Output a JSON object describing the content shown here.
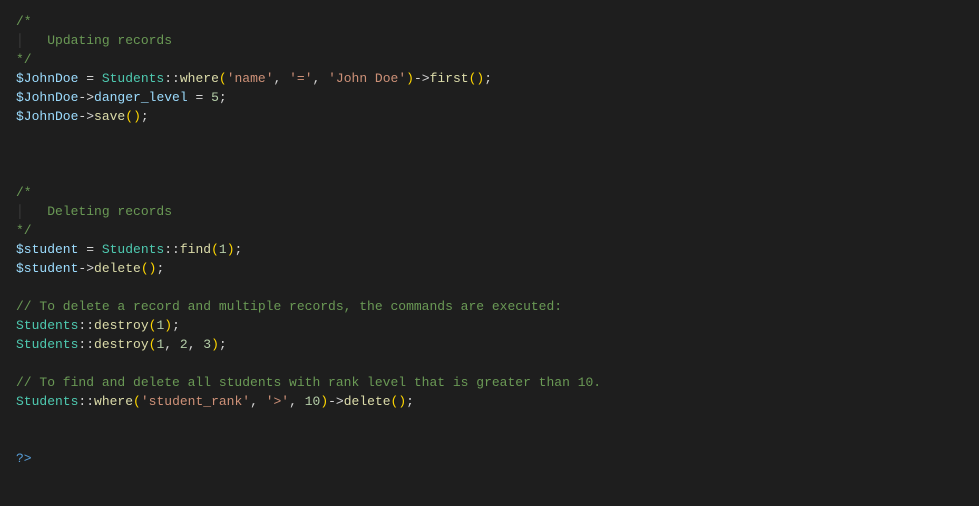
{
  "code": {
    "l1": "/*",
    "l2_indent": "    ",
    "l2_text": "Updating records",
    "l3": "*/",
    "l4_var": "$JohnDoe",
    "l4_eq": " = ",
    "l4_class": "Students",
    "l4_dcolon": "::",
    "l4_fn1": "where",
    "l4_p1": "(",
    "l4_s1": "'name'",
    "l4_c1": ", ",
    "l4_s2": "'='",
    "l4_c2": ", ",
    "l4_s3": "'John Doe'",
    "l4_p2": ")",
    "l4_arrow": "->",
    "l4_fn2": "first",
    "l4_p3": "(",
    "l4_p4": ")",
    "l4_semi": ";",
    "l5_var": "$JohnDoe",
    "l5_arrow": "->",
    "l5_prop": "danger_level",
    "l5_eq": " = ",
    "l5_num": "5",
    "l5_semi": ";",
    "l6_var": "$JohnDoe",
    "l6_arrow": "->",
    "l6_fn": "save",
    "l6_p1": "(",
    "l6_p2": ")",
    "l6_semi": ";",
    "l10": "/*",
    "l11_indent": "    ",
    "l11_text": "Deleting records",
    "l12": "*/",
    "l13_var": "$student",
    "l13_eq": " = ",
    "l13_class": "Students",
    "l13_dcolon": "::",
    "l13_fn": "find",
    "l13_p1": "(",
    "l13_num": "1",
    "l13_p2": ")",
    "l13_semi": ";",
    "l14_var": "$student",
    "l14_arrow": "->",
    "l14_fn": "delete",
    "l14_p1": "(",
    "l14_p2": ")",
    "l14_semi": ";",
    "l16": "// To delete a record and multiple records, the commands are executed:",
    "l17_class": "Students",
    "l17_dcolon": "::",
    "l17_fn": "destroy",
    "l17_p1": "(",
    "l17_num": "1",
    "l17_p2": ")",
    "l17_semi": ";",
    "l18_class": "Students",
    "l18_dcolon": "::",
    "l18_fn": "destroy",
    "l18_p1": "(",
    "l18_n1": "1",
    "l18_c1": ", ",
    "l18_n2": "2",
    "l18_c2": ", ",
    "l18_n3": "3",
    "l18_p2": ")",
    "l18_semi": ";",
    "l20": "// To find and delete all students with rank level that is greater than 10.",
    "l21_class": "Students",
    "l21_dcolon": "::",
    "l21_fn1": "where",
    "l21_p1": "(",
    "l21_s1": "'student_rank'",
    "l21_c1": ", ",
    "l21_s2": "'>'",
    "l21_c2": ", ",
    "l21_num": "10",
    "l21_p2": ")",
    "l21_arrow": "->",
    "l21_fn2": "delete",
    "l21_p3": "(",
    "l21_p4": ")",
    "l21_semi": ";",
    "l24": "?>"
  }
}
